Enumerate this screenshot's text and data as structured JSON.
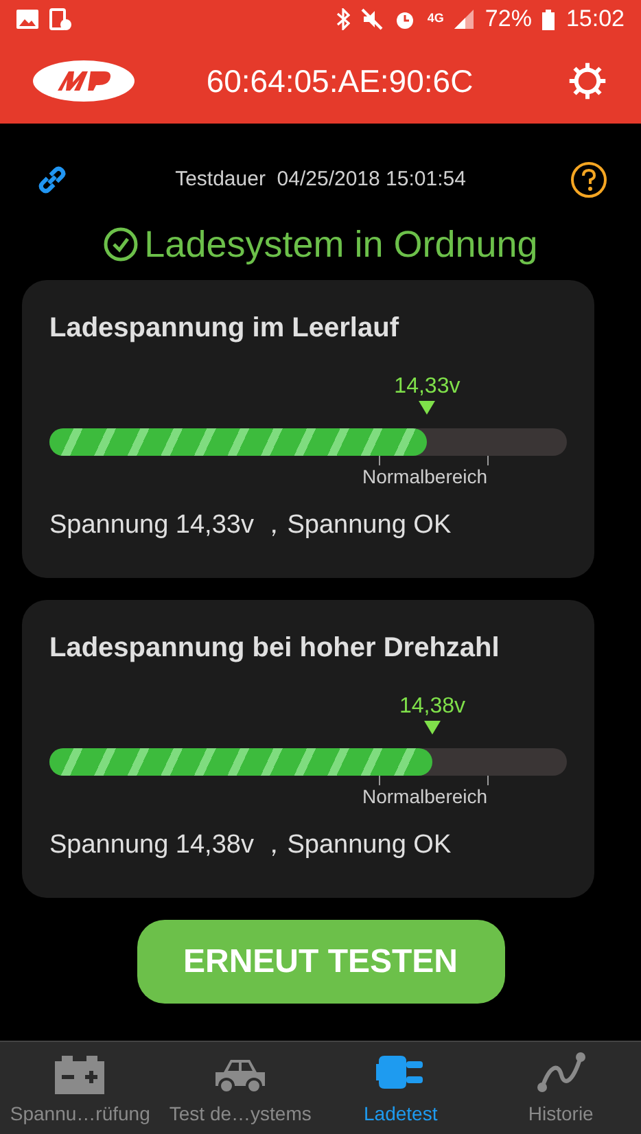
{
  "status_bar": {
    "network": "4G",
    "battery": "72%",
    "time": "15:02"
  },
  "app_bar": {
    "title": "60:64:05:AE:90:6C"
  },
  "test_info": {
    "label": "Testdauer",
    "datetime": "04/25/2018 15:01:54"
  },
  "result": {
    "text": "Ladesystem in Ordnung",
    "ok": true
  },
  "cards": [
    {
      "title": "Ladespannung im Leerlauf",
      "reading": "14,33v",
      "level": 0.73,
      "range_label": "Normalbereich",
      "summary": "Spannung 14,33v ，Spannung OK"
    },
    {
      "title": "Ladespannung bei hoher Drehzahl",
      "reading": "14,38v",
      "level": 0.74,
      "range_label": "Normalbereich",
      "summary": "Spannung 14,38v ，Spannung OK"
    }
  ],
  "action_button": "ERNEUT TESTEN",
  "tabs": [
    {
      "kind": "battery",
      "label": "Spannu…rüfung",
      "selected": false
    },
    {
      "kind": "car",
      "label": "Test de…ystems",
      "selected": false
    },
    {
      "kind": "plug",
      "label": "Ladetest",
      "selected": true
    },
    {
      "kind": "curve",
      "label": "Historie",
      "selected": false
    }
  ]
}
